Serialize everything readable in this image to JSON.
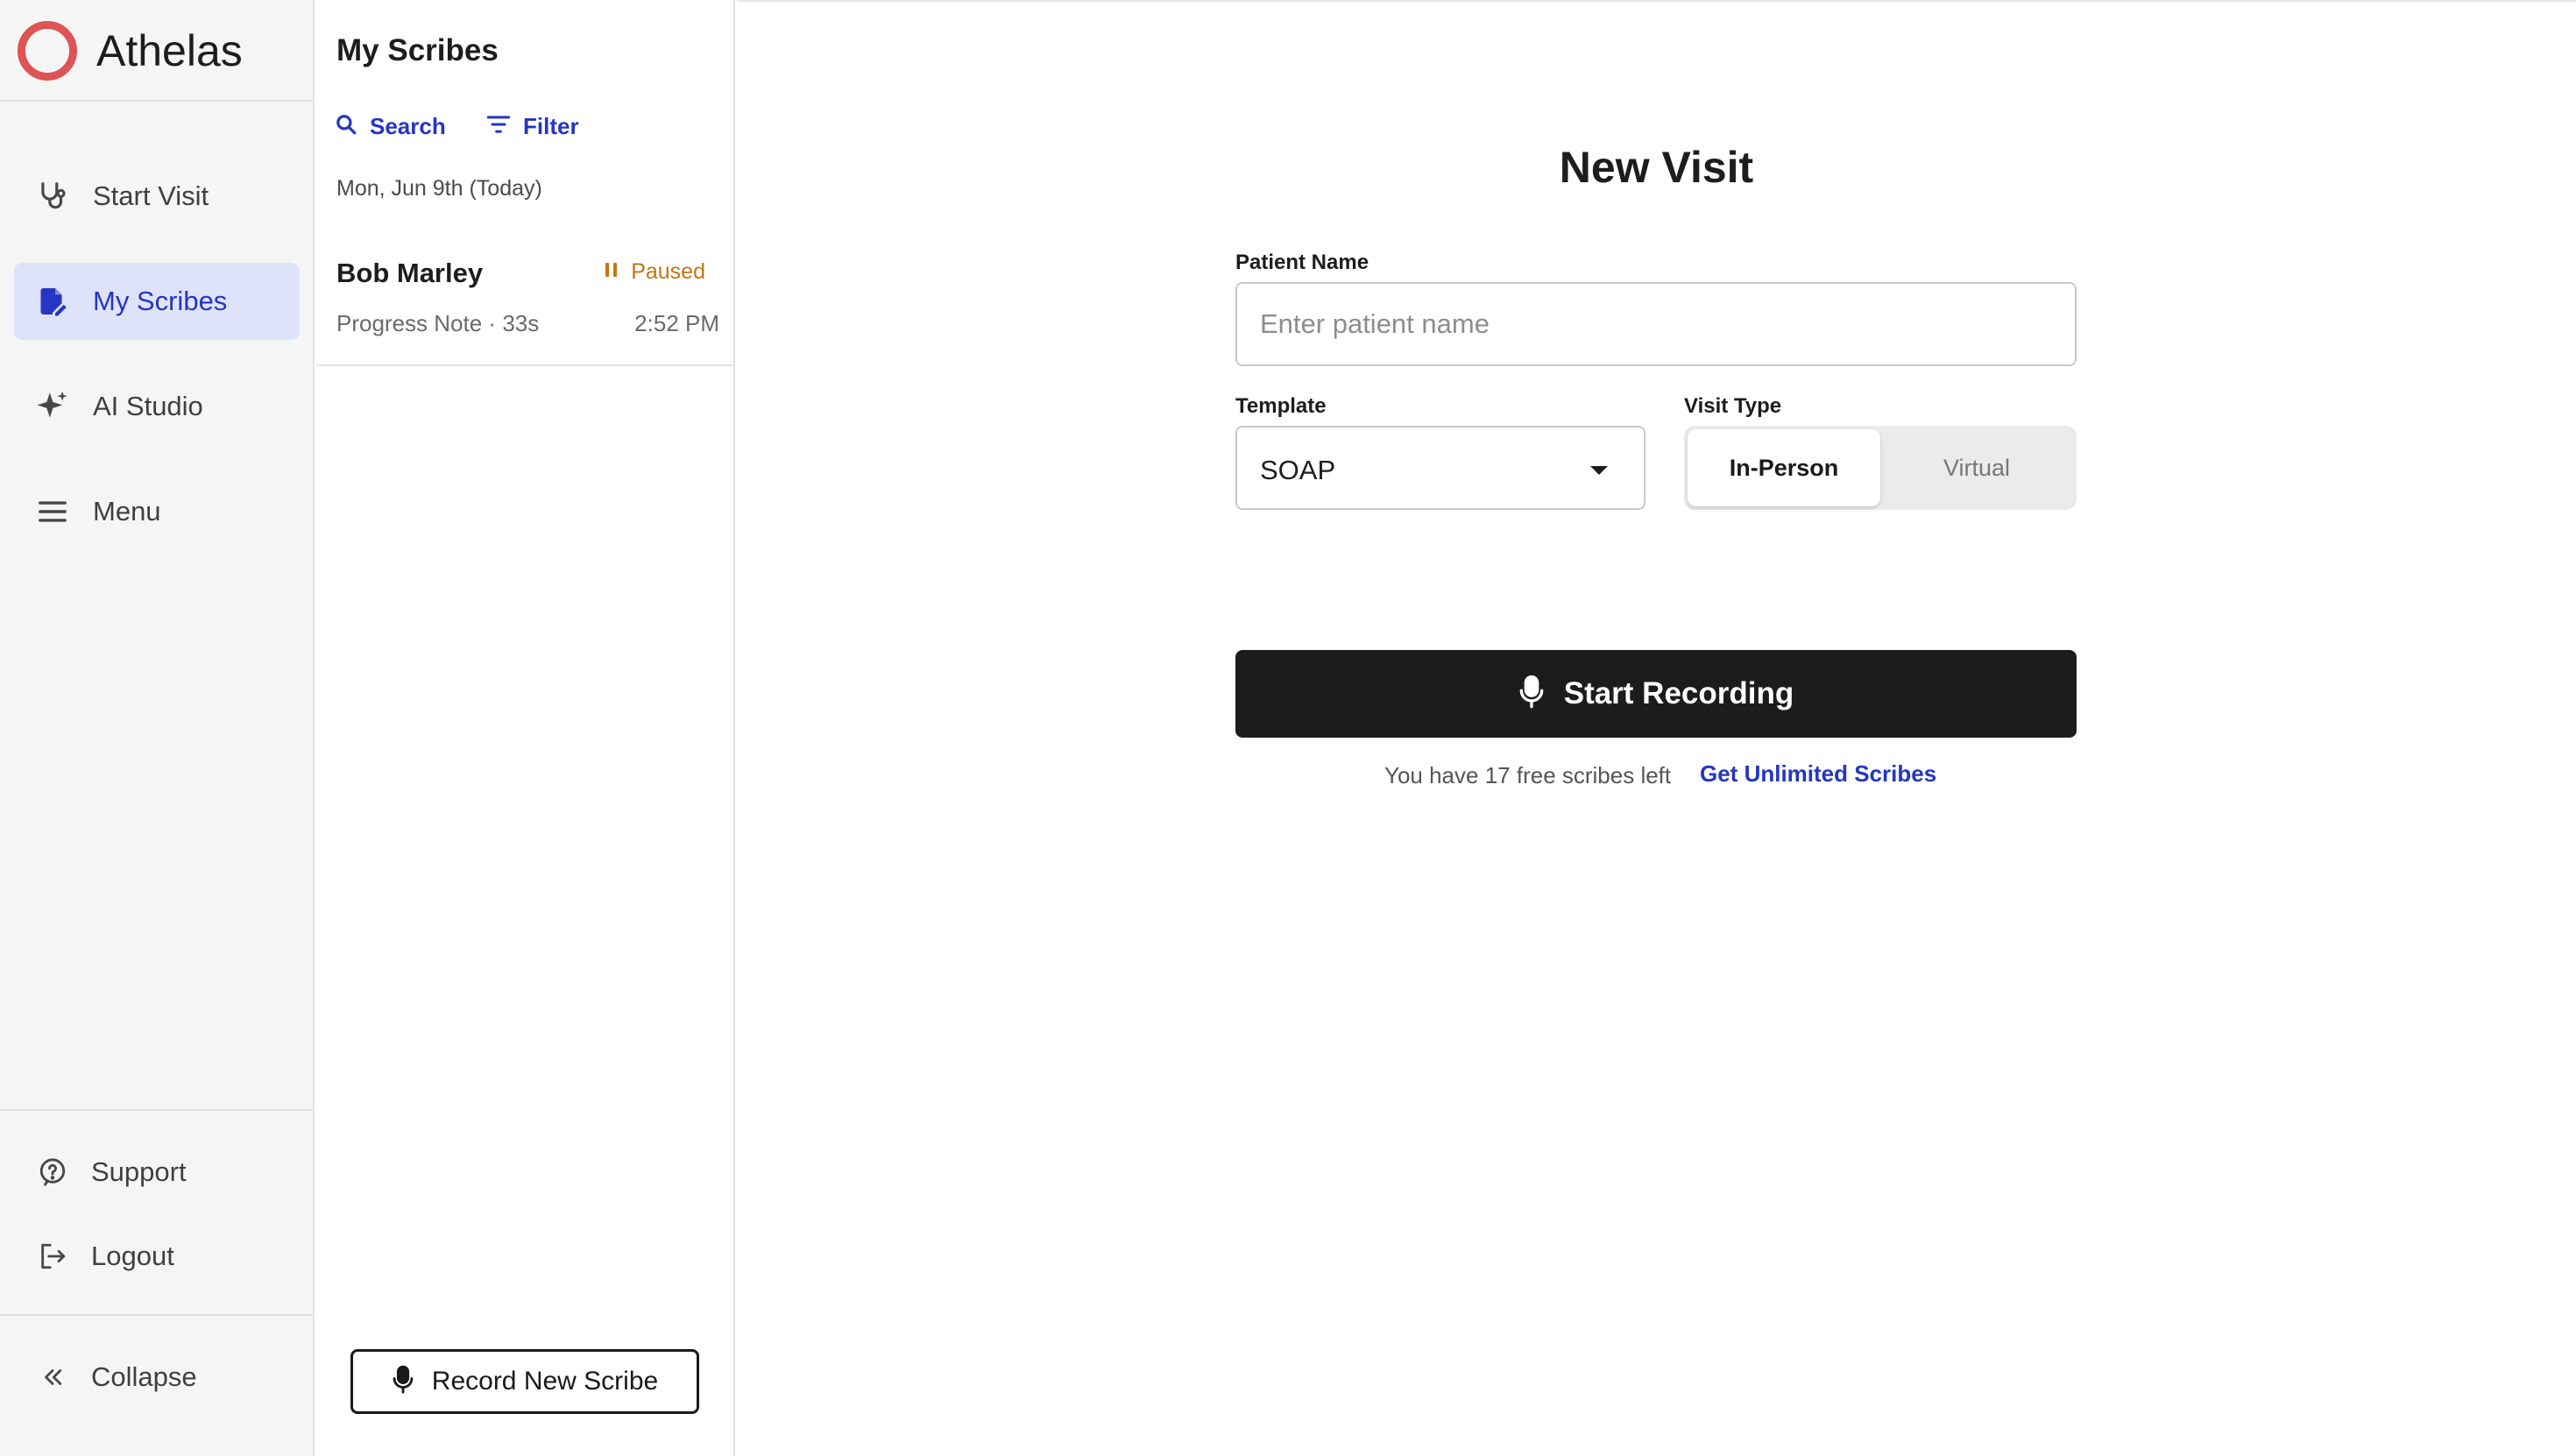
{
  "brand": {
    "name": "Athelas",
    "accent_color": "#de5353"
  },
  "nav": {
    "items": [
      {
        "label": "Start Visit",
        "icon": "stethoscope-icon"
      },
      {
        "label": "My Scribes",
        "icon": "document-edit-icon",
        "active": true
      },
      {
        "label": "AI Studio",
        "icon": "sparkle-icon"
      },
      {
        "label": "Menu",
        "icon": "hamburger-menu-icon"
      }
    ],
    "footer": [
      {
        "label": "Support",
        "icon": "help-circle-icon"
      },
      {
        "label": "Logout",
        "icon": "logout-icon"
      },
      {
        "label": "Collapse",
        "icon": "double-chevron-left-icon"
      }
    ]
  },
  "scribes_panel": {
    "title": "My Scribes",
    "search_label": "Search",
    "filter_label": "Filter",
    "date_heading": "Mon, Jun 9th (Today)",
    "items": [
      {
        "name": "Bob Marley",
        "status": "Paused",
        "note_type": "Progress Note",
        "separator": "·",
        "duration": "33s",
        "time": "2:52 PM"
      }
    ],
    "record_button": "Record New Scribe"
  },
  "new_visit": {
    "title": "New Visit",
    "patient_name": {
      "label": "Patient Name",
      "placeholder": "Enter patient name",
      "value": ""
    },
    "template": {
      "label": "Template",
      "value": "SOAP"
    },
    "visit_type": {
      "label": "Visit Type",
      "options": [
        "In-Person",
        "Virtual"
      ],
      "selected": "In-Person"
    },
    "start_button": "Start Recording",
    "quota_text": "You have 17 free scribes left",
    "upgrade_link": "Get Unlimited Scribes"
  },
  "colors": {
    "active_blue": "#2535c4",
    "active_nav_bg": "#dfe3fa",
    "paused_orange": "#c27611",
    "primary_button": "#1c1c1c"
  }
}
